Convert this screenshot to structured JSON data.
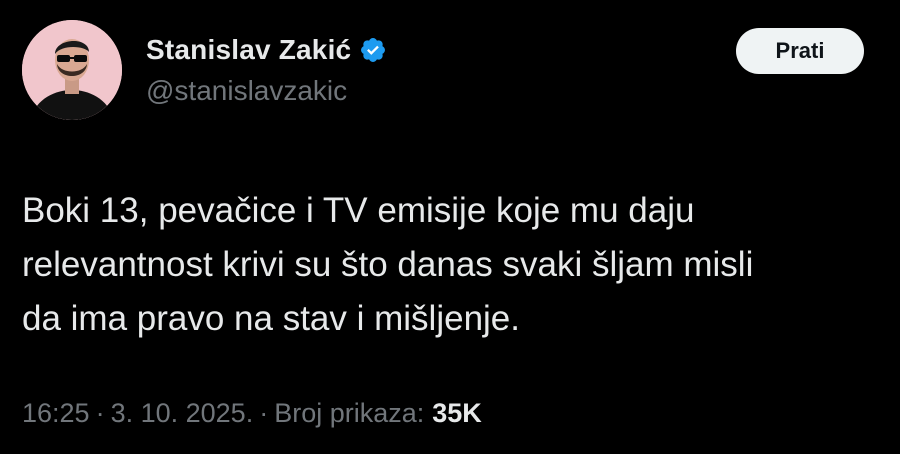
{
  "author": {
    "display_name": "Stanislav Zakić",
    "handle": "@stanislavzakic",
    "verified_icon": "verified-badge-icon",
    "avatar_bg": "#f1c6cc"
  },
  "follow_button": {
    "label": "Prati"
  },
  "tweet": {
    "lines": [
      "Boki 13, pevačice i TV emisije koje mu daju",
      "relevantnost krivi su što danas svaki šljam misli",
      "da ima pravo na stav i mišljenje."
    ]
  },
  "meta": {
    "time": "16:25",
    "separator": "·",
    "date": "3. 10. 2025.",
    "views_label": "Broj prikaza:",
    "views_count": "35K"
  },
  "colors": {
    "background": "#000000",
    "primary_text": "#e7e9ea",
    "secondary_text": "#71767b",
    "verified_blue": "#1d9bf0",
    "button_bg": "#eff3f4"
  }
}
